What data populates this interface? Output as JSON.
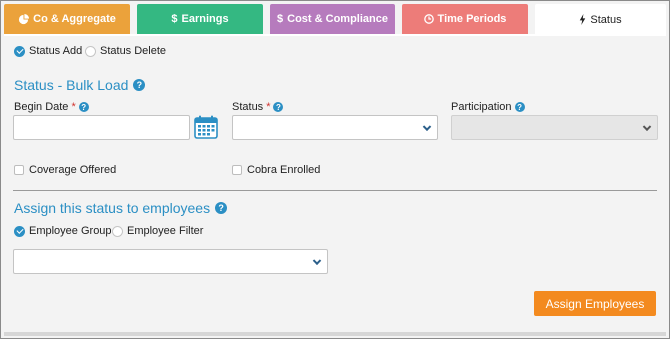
{
  "tabs": {
    "co_aggregate": {
      "label": "Co & Aggregate",
      "icon": "pie-chart-icon",
      "color": "#eba23b"
    },
    "earnings": {
      "label": "Earnings",
      "icon": "dollar-icon",
      "color": "#34b882"
    },
    "cost_compliance": {
      "label": "Cost & Compliance",
      "icon": "dollar-icon",
      "color": "#b67bbd"
    },
    "time_periods": {
      "label": "Time Periods",
      "icon": "clock-icon",
      "color": "#ed7c79"
    },
    "status": {
      "label": "Status",
      "icon": "bolt-icon",
      "selected": true
    }
  },
  "mode": {
    "add_label": "Status Add",
    "delete_label": "Status Delete",
    "selected": "add"
  },
  "bulk_load": {
    "title": "Status - Bulk Load",
    "begin_date": {
      "label": "Begin Date",
      "required_mark": "*",
      "value": ""
    },
    "status": {
      "label": "Status",
      "required_mark": "*",
      "value": ""
    },
    "participation": {
      "label": "Participation",
      "value": "",
      "disabled": true
    },
    "coverage_offered": {
      "label": "Coverage Offered",
      "checked": false
    },
    "cobra_enrolled": {
      "label": "Cobra Enrolled",
      "checked": false
    }
  },
  "assign": {
    "title": "Assign this status to employees",
    "employee_group_label": "Employee Group",
    "employee_filter_label": "Employee Filter",
    "selected": "employee_group",
    "group_value": ""
  },
  "actions": {
    "assign_button": "Assign Employees"
  },
  "colors": {
    "accent": "#2b8fc4",
    "button": "#f38a1f",
    "required": "#d0332f"
  }
}
